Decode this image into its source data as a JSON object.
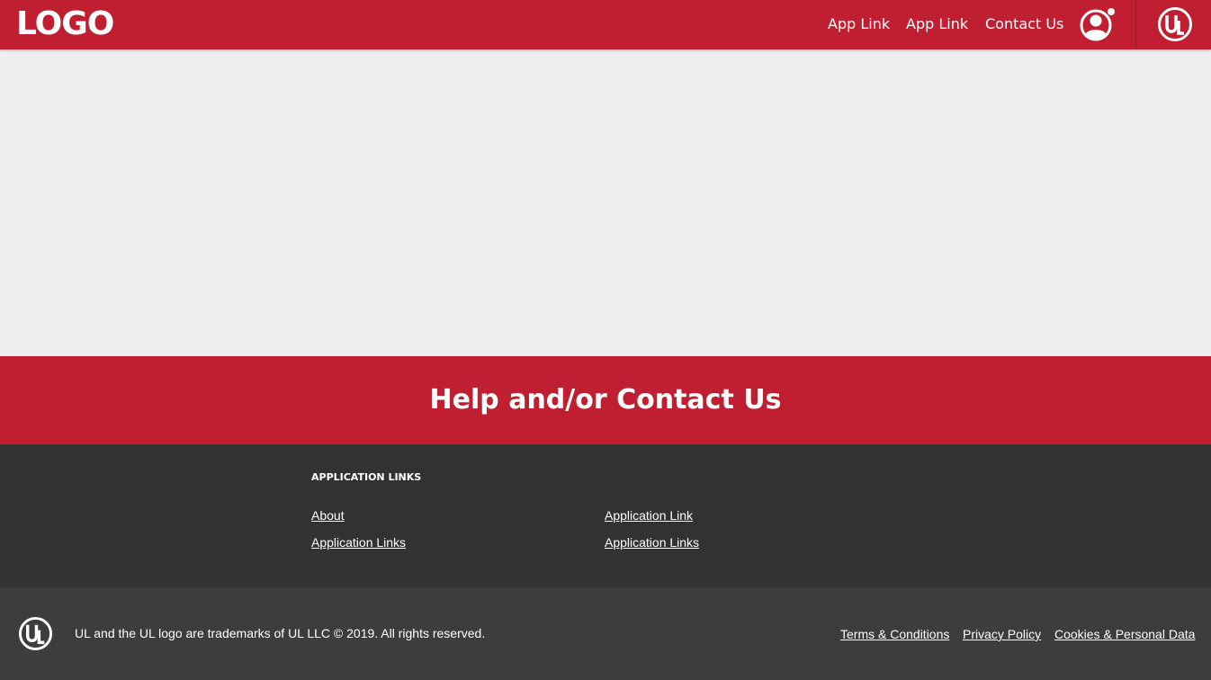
{
  "header": {
    "logo_text": "LOGO",
    "nav": [
      "App Link",
      "App Link",
      "Contact Us"
    ],
    "user_icon": "user-avatar-icon",
    "brand_icon": "ul-logo-icon"
  },
  "help": {
    "title": "Help and/or Contact Us"
  },
  "footer_links": {
    "heading": "APPLICATION LINKS",
    "column1": [
      "About",
      "Application Links"
    ],
    "column2": [
      "Application Link",
      "Application Links"
    ]
  },
  "bottom": {
    "brand_icon": "ul-logo-icon",
    "copyright": "UL and the UL logo are trademarks of UL LLC © 2019. All rights reserved.",
    "legal_links": [
      "Terms & Conditions",
      "Privacy Policy",
      "Cookies & Personal Data"
    ]
  },
  "colors": {
    "brand_red": "#c01f31",
    "page_background": "#efefef",
    "links_background": "#323232",
    "bottom_background": "#3d3d3d"
  }
}
